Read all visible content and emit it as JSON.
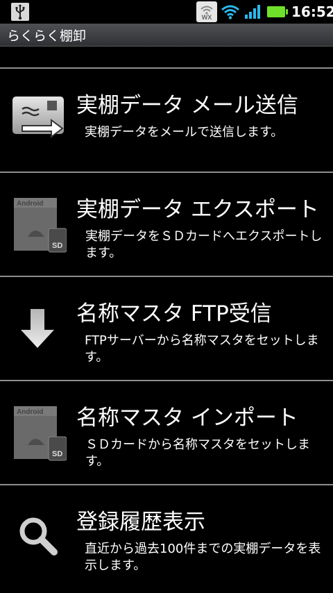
{
  "status_bar": {
    "wx_label": "WX",
    "time": "16:52",
    "battery_color": "#6fe12a",
    "icons": [
      "usb-icon",
      "weather-wx-icon",
      "wifi-icon",
      "signal-icon",
      "battery-icon"
    ]
  },
  "title_bar": {
    "title": "らくらく棚卸"
  },
  "menu": {
    "items": [
      {
        "title": "実棚データ メール送信",
        "description": "実棚データをメールで送信します。",
        "icon": "email-send-icon"
      },
      {
        "title": "実棚データ エクスポート",
        "description": "実棚データをＳＤカードへエクスポートします。",
        "icon": "sd-card-export-icon"
      },
      {
        "title": "名称マスタ FTP受信",
        "description": "FTPサーバーから名称マスタをセットします。",
        "icon": "download-arrow-icon"
      },
      {
        "title": "名称マスタ インポート",
        "description": "ＳＤカードから名称マスタをセットします。",
        "icon": "sd-card-import-icon"
      },
      {
        "title": "登録履歴表示",
        "description": "直近から過去100件までの実棚データを表示します。",
        "icon": "search-icon"
      }
    ]
  },
  "sd_icon": {
    "brand_label": "Android",
    "card_label": "SD"
  }
}
